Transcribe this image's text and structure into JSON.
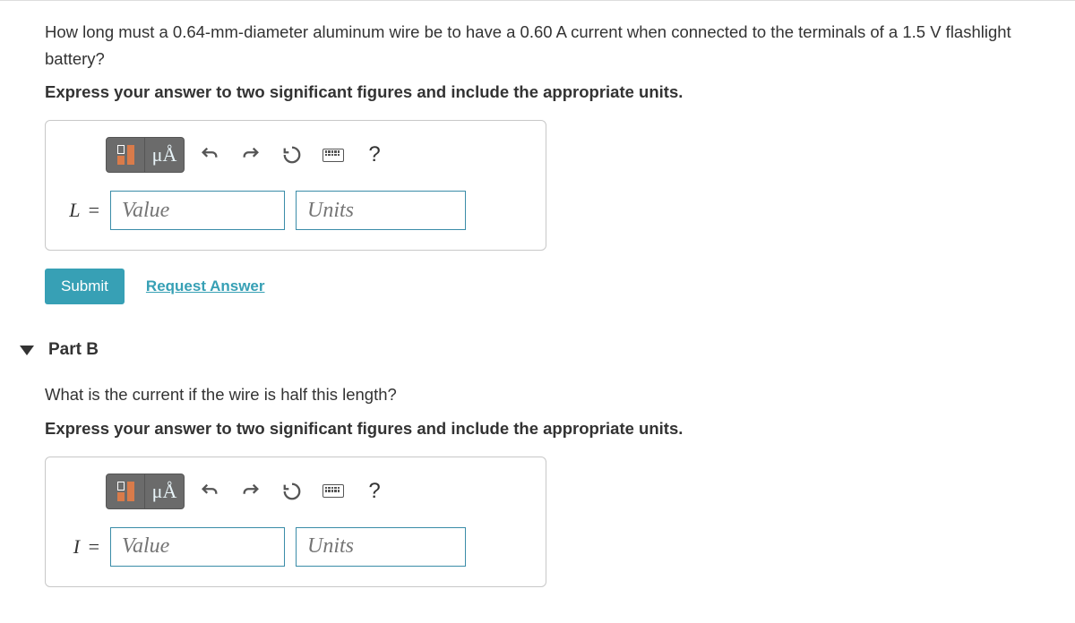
{
  "partA": {
    "question": "How long must a 0.64-mm-diameter aluminum wire be to have a 0.60 A current when connected to the terminals of a 1.5 V flashlight battery?",
    "instruction": "Express your answer to two significant figures and include the appropriate units.",
    "variable": "L",
    "equals": "=",
    "value_placeholder": "Value",
    "units_placeholder": "Units",
    "toolbar": {
      "special_chars": "μÅ"
    },
    "submit_label": "Submit",
    "request_label": "Request Answer"
  },
  "partB": {
    "title": "Part B",
    "question": "What is the current if the wire is half this length?",
    "instruction": "Express your answer to two significant figures and include the appropriate units.",
    "variable": "I",
    "equals": "=",
    "value_placeholder": "Value",
    "units_placeholder": "Units",
    "toolbar": {
      "special_chars": "μÅ"
    }
  },
  "help_symbol": "?"
}
